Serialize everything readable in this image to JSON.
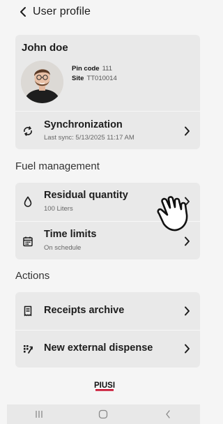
{
  "header": {
    "title": "User profile",
    "back_icon": "chevron-left-icon"
  },
  "user": {
    "name": "John doe",
    "pin_label": "Pin code",
    "pin_value": "111",
    "site_label": "Site",
    "site_value": "TT010014"
  },
  "sync": {
    "title": "Synchronization",
    "subtitle": "Last sync: 5/13/2025 11:17 AM",
    "icon": "sync-icon"
  },
  "fuel": {
    "section_title": "Fuel management",
    "items": [
      {
        "title": "Residual quantity",
        "subtitle": "100 Liters",
        "icon": "drop-icon"
      },
      {
        "title": "Time limits",
        "subtitle": "On schedule",
        "icon": "calendar-icon"
      }
    ]
  },
  "actions": {
    "section_title": "Actions",
    "items": [
      {
        "title": "Receipts archive",
        "icon": "receipt-icon"
      },
      {
        "title": "New external dispense",
        "icon": "external-dispense-icon"
      }
    ]
  },
  "brand": {
    "logo_text": "PIUSI"
  },
  "navbar": {
    "items": [
      "recents-icon",
      "home-icon",
      "back-icon"
    ]
  },
  "colors": {
    "background": "#f5f5f5",
    "card": "#e9e9e9",
    "text": "#1c1c1c"
  }
}
